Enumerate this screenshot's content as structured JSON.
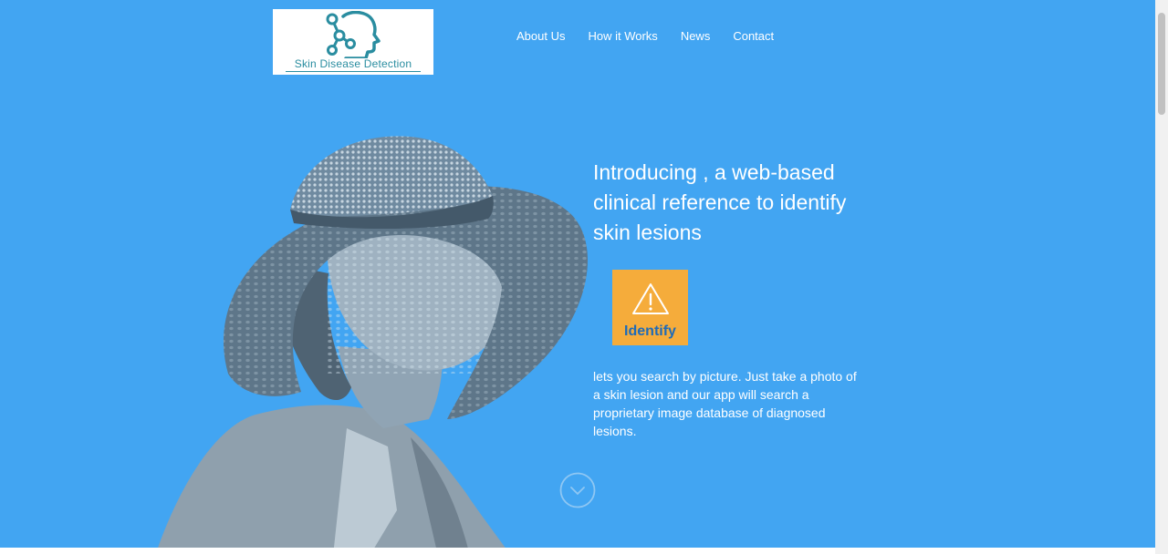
{
  "logo": {
    "text": "Skin Disease Detection",
    "icon": "head-network-icon"
  },
  "nav": {
    "items": [
      {
        "label": "About Us"
      },
      {
        "label": "How it Works"
      },
      {
        "label": "News"
      },
      {
        "label": "Contact"
      }
    ]
  },
  "hero": {
    "headline": "Introducing , a web-based clinical reference to identify skin lesions",
    "button_label": "Identify",
    "button_icon": "warning-icon",
    "description": "lets you search by picture. Just take a photo of a skin lesion and our app will search a proprietary image database of diagnosed lesions.",
    "scroll_icon": "chevron-down-circle-icon"
  },
  "colors": {
    "hero_bg": "#42a5f2",
    "button_bg": "#f5ac3b",
    "button_text": "#1e6bb8",
    "logo_teal": "#2a8da0"
  }
}
